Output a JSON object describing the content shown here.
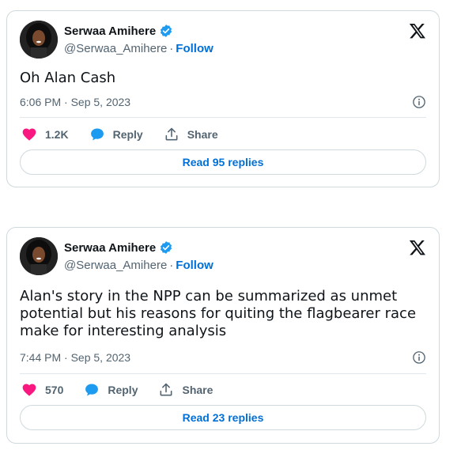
{
  "colors": {
    "accent": "#006fd6",
    "heart": "#f91880",
    "reply": "#1d9bf0",
    "muted": "#536471",
    "border": "#cfd9de"
  },
  "tweets": [
    {
      "author": {
        "name": "Serwaa Amihere",
        "handle": "@Serwaa_Amihere",
        "follow_label": "Follow",
        "verified": true
      },
      "text": "Oh Alan Cash",
      "timestamp": "6:06 PM · Sep 5, 2023",
      "likes": "1.2K",
      "reply_label": "Reply",
      "share_label": "Share",
      "read_replies_label": "Read 95 replies"
    },
    {
      "author": {
        "name": "Serwaa Amihere",
        "handle": "@Serwaa_Amihere",
        "follow_label": "Follow",
        "verified": true
      },
      "text": "Alan's story in the NPP can be summarized as unmet\npotential but his reasons for quiting the flagbearer race\nmake for interesting analysis",
      "timestamp": "7:44 PM · Sep 5, 2023",
      "likes": "570",
      "reply_label": "Reply",
      "share_label": "Share",
      "read_replies_label": "Read 23 replies"
    }
  ],
  "icons": {
    "platform": "x-logo-icon",
    "verified": "verified-badge-icon",
    "info": "info-icon",
    "like": "heart-icon",
    "reply": "reply-bubble-icon",
    "share": "share-upload-icon"
  }
}
